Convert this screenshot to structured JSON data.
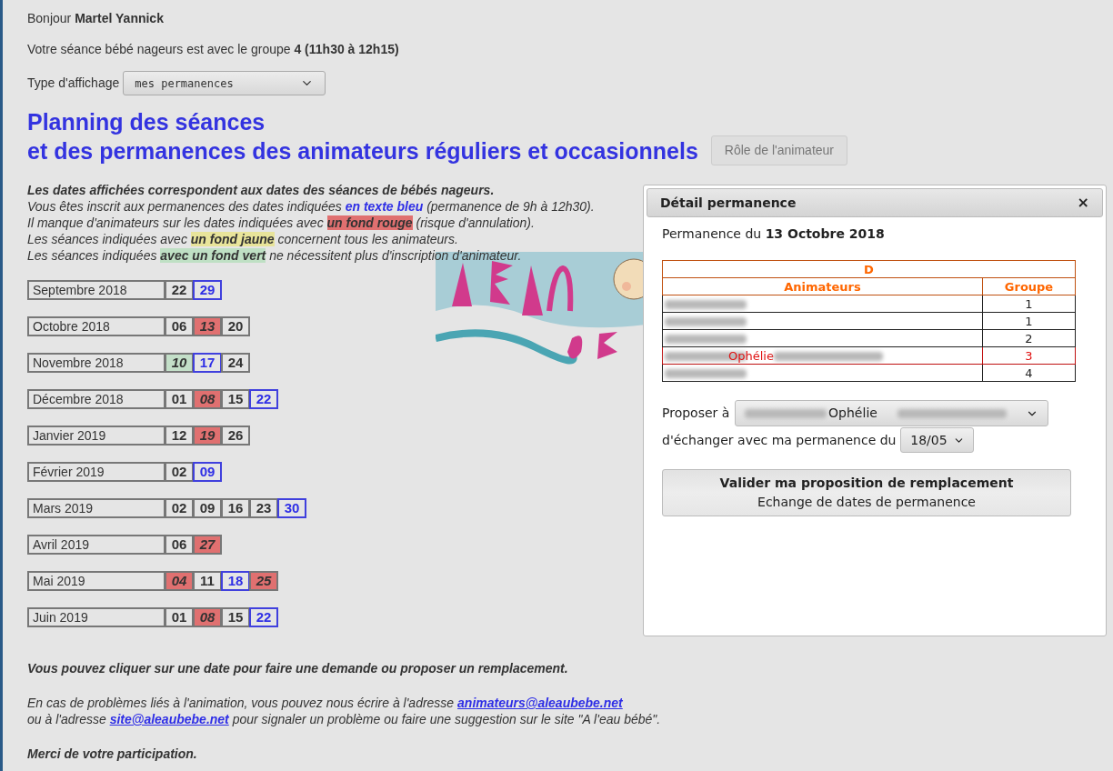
{
  "greeting": "Bonjour **Martel Yannick**",
  "session": "Votre séance bébé nageurs est avec le groupe **4 (11h30 à 12h15)**",
  "display_type": {
    "label": "Type d'affichage",
    "value": "mes permanences"
  },
  "title": [
    "Planning des séances",
    "et des permanences des animateurs réguliers et occasionnels"
  ],
  "role_button": "Rôle de l'animateur",
  "legend": [
    {
      "parts": [
        {
          "text": "Les dates affichées correspondent aux dates des séances de bébés nageurs.",
          "kind": "emphasis"
        }
      ]
    },
    {
      "parts": [
        {
          "text": "Vous êtes inscrit aux permanences des dates indiquées",
          "kind": "text"
        },
        {
          "text": "en texte bleu",
          "kind": "mine"
        },
        {
          "text": "(permanence de 9h à 12h30).",
          "kind": "text"
        }
      ]
    },
    {
      "parts": [
        {
          "text": "Il manque d'animateurs sur les dates indiquées avec",
          "kind": "text"
        },
        {
          "text": "un fond rouge",
          "kind": "missing"
        },
        {
          "text": "(risque d'annulation).",
          "kind": "text"
        }
      ]
    },
    {
      "parts": [
        {
          "text": "Les séances indiquées avec",
          "kind": "text"
        },
        {
          "text": "un fond jaune",
          "kind": "all"
        },
        {
          "text": "concernent tous les animateurs.",
          "kind": "text"
        }
      ]
    },
    {
      "parts": [
        {
          "text": "Les séances indiquées",
          "kind": "text"
        },
        {
          "text": "avec un fond vert",
          "kind": "full"
        },
        {
          "text": "ne nécessitent plus d'inscription d'animateur.",
          "kind": "text"
        }
      ]
    }
  ],
  "months": [
    {
      "name": "Septembre 2018",
      "dates": [
        {
          "day": "22",
          "kind": "plain"
        },
        {
          "day": "29",
          "kind": "mine"
        }
      ]
    },
    {
      "name": "Octobre 2018",
      "dates": [
        {
          "day": "06",
          "kind": "plain"
        },
        {
          "day": "13",
          "kind": "missing"
        },
        {
          "day": "20",
          "kind": "plain"
        }
      ]
    },
    {
      "name": "Novembre 2018",
      "dates": [
        {
          "day": "10",
          "kind": "full"
        },
        {
          "day": "17",
          "kind": "mine"
        },
        {
          "day": "24",
          "kind": "plain"
        }
      ]
    },
    {
      "name": "Décembre 2018",
      "dates": [
        {
          "day": "01",
          "kind": "plain"
        },
        {
          "day": "08",
          "kind": "missing"
        },
        {
          "day": "15",
          "kind": "plain"
        },
        {
          "day": "22",
          "kind": "mine"
        }
      ]
    },
    {
      "name": "Janvier 2019",
      "dates": [
        {
          "day": "12",
          "kind": "plain"
        },
        {
          "day": "19",
          "kind": "missing"
        },
        {
          "day": "26",
          "kind": "plain"
        }
      ]
    },
    {
      "name": "Février 2019",
      "dates": [
        {
          "day": "02",
          "kind": "plain"
        },
        {
          "day": "09",
          "kind": "mine"
        }
      ]
    },
    {
      "name": "Mars 2019",
      "dates": [
        {
          "day": "02",
          "kind": "plain"
        },
        {
          "day": "09",
          "kind": "plain"
        },
        {
          "day": "16",
          "kind": "plain"
        },
        {
          "day": "23",
          "kind": "plain"
        },
        {
          "day": "30",
          "kind": "mine"
        }
      ]
    },
    {
      "name": "Avril 2019",
      "dates": [
        {
          "day": "06",
          "kind": "plain"
        },
        {
          "day": "27",
          "kind": "missing"
        }
      ]
    },
    {
      "name": "Mai 2019",
      "dates": [
        {
          "day": "04",
          "kind": "missing"
        },
        {
          "day": "11",
          "kind": "plain"
        },
        {
          "day": "18",
          "kind": "mine"
        },
        {
          "day": "25",
          "kind": "missing"
        }
      ]
    },
    {
      "name": "Juin 2019",
      "dates": [
        {
          "day": "01",
          "kind": "plain"
        },
        {
          "day": "08",
          "kind": "missing"
        },
        {
          "day": "15",
          "kind": "plain"
        },
        {
          "day": "22",
          "kind": "mine"
        }
      ]
    }
  ],
  "footer": [
    {
      "kind": "emphasis",
      "parts": [
        {
          "text": "Vous pouvez cliquer sur une date pour faire une demande ou proposer un remplacement.",
          "kind": "text"
        }
      ]
    },
    {
      "kind": "normal",
      "parts": [
        {
          "text": "En cas de problèmes liés à l'animation, vous pouvez nous écrire à l'adresse",
          "kind": "text"
        },
        {
          "text": "animateurs@aleaubebe.net",
          "kind": "link"
        }
      ]
    },
    {
      "kind": "normal",
      "parts": [
        {
          "text": "ou à l'adresse",
          "kind": "text"
        },
        {
          "text": "site@aleaubebe.net",
          "kind": "link"
        },
        {
          "text": "pour signaler un problème ou faire une suggestion sur le site \"A l'eau bébé\".",
          "kind": "text"
        }
      ]
    },
    {
      "kind": "emphasis",
      "parts": [
        {
          "text": "Merci de votre participation.",
          "kind": "text"
        }
      ]
    }
  ],
  "dialog": {
    "title": "Détail permanence",
    "close": "×",
    "date_line": "Permanence du **13 Octobre 2018**",
    "table": {
      "caption": "D",
      "columns": [
        "Animateurs",
        "Groupe"
      ],
      "rows": [
        {
          "group": "1",
          "selected": false
        },
        {
          "group": "1",
          "selected": false
        },
        {
          "group": "2",
          "selected": false
        },
        {
          "name": "Ophélie",
          "group": "3",
          "selected": true
        },
        {
          "group": "4",
          "selected": false
        }
      ]
    },
    "propose_label": "Proposer à",
    "propose_value": "Ophélie",
    "exchange_label": "d'échanger avec ma permanence du",
    "exchange_value": "18/05",
    "submit": {
      "title": "Valider ma proposition de remplacement",
      "subtitle": "Echange de dates de permanence"
    }
  }
}
